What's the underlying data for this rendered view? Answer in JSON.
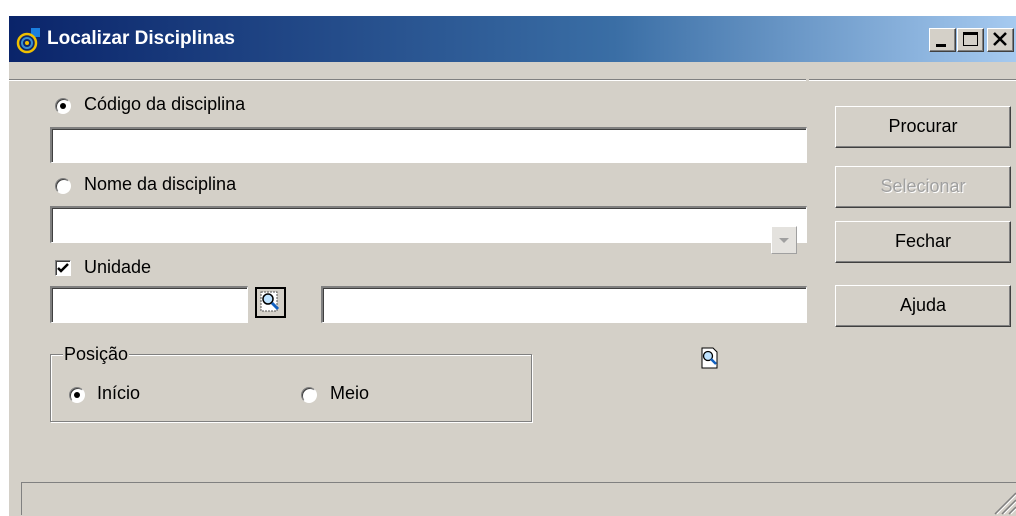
{
  "window": {
    "title": "Localizar Disciplinas",
    "title_bar_buttons": [
      "minimize-icon",
      "maximize-icon",
      "close-icon"
    ]
  },
  "search_by_code": {
    "label": "Código da disciplina",
    "selected": true,
    "value": ""
  },
  "search_by_name": {
    "label": "Nome da disciplina",
    "selected": false,
    "value": ""
  },
  "unit": {
    "label": "Unidade",
    "checked": true,
    "code_value": "",
    "name_value": "",
    "lookup_icon": "search-icon"
  },
  "position_group": {
    "legend": "Posição",
    "options": [
      {
        "label": "Início",
        "selected": true
      },
      {
        "label": "Meio",
        "selected": false
      }
    ]
  },
  "buttons": {
    "search": "Procurar",
    "select": "Selecionar",
    "close": "Fechar",
    "help": "Ajuda"
  },
  "colors": {
    "titlebar_start": "#0a246a",
    "titlebar_end": "#a6caf0",
    "face": "#d4d0c8",
    "disabled_text": "#a0a0a0"
  }
}
